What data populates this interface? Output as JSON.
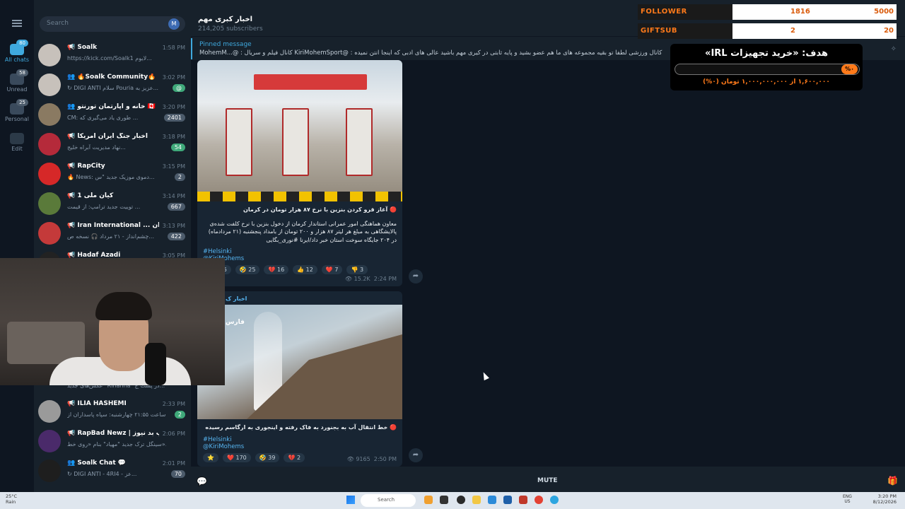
{
  "rail": {
    "items": [
      {
        "label": "All chats",
        "badge": "80"
      },
      {
        "label": "Unread",
        "badge": "58"
      },
      {
        "label": "Personal",
        "badge": "25"
      },
      {
        "label": "Edit",
        "badge": ""
      }
    ]
  },
  "search": {
    "placeholder": "Search"
  },
  "chats": [
    {
      "name": "📢 Soalk",
      "time": "1:58 PM",
      "preview": "https://kick.com/Soalk1 لایوم...",
      "badge": ""
    },
    {
      "name": "👥 🔥Soalk Community🔥",
      "time": "3:02 PM",
      "preview": "↻ DIGI ANTI سلام Pouria عزیز به...",
      "badge": "@"
    },
    {
      "name": "👥 خانه و آپارتمان تورنتو 🇨🇦",
      "time": "3:20 PM",
      "preview": "CM: طوری یاد می‌گیری که ...",
      "badge": "2401"
    },
    {
      "name": "📢 اخبار جنگ ایران امریکا",
      "time": "3:18 PM",
      "preview": "نهاد مدیریت آبراه خلیج...",
      "badge": "54"
    },
    {
      "name": "📢 RapCity",
      "time": "3:15 PM",
      "preview": "🔥 News: دموی موزیک جدید \"س...",
      "badge": "2"
    },
    {
      "name": "📢 کیان ملی 1",
      "time": "3:14 PM",
      "preview": "توییت جدید ترامپ: از قیمت ...",
      "badge": "667"
    },
    {
      "name": "📢 Iran International ... ایران",
      "time": "3:13 PM",
      "preview": "چشم‌انداز - ۲۱ مرداد 🎧 نسخه ص...",
      "badge": "422"
    },
    {
      "name": "📢 Hadaf Azadi",
      "time": "3:05 PM",
      "preview": "",
      "badge": ""
    },
    {
      "name": "",
      "time": "",
      "preview": "عکس‌های جدید \"Rihanna\" در پست ج...",
      "badge": ""
    },
    {
      "name": "📢 ILIA HASHEMI",
      "time": "2:33 PM",
      "preview": "ساعت ۲۱:۵۵ چهارشنبه: سپاه پاسداران از...",
      "badge": "2"
    },
    {
      "name": "📢 RapBad Newz | رپ بد نیوز",
      "time": "2:06 PM",
      "preview": "سینگل ترک جدید \"مهیاد\" بنام «روی خط»...",
      "badge": ""
    },
    {
      "name": "👥 Soalk Chat 💬",
      "time": "2:01 PM",
      "preview": "↻ DIGI ANTI - 4RI4 - عز...",
      "badge": "70"
    }
  ],
  "header": {
    "title": "اخبار کبری مهم",
    "subscribers": "214,205 subscribers"
  },
  "pinned": {
    "label": "Pinned message",
    "text": "MohemM...@ : کانال فیلم و سریال  KiriMohemSport@ : کانال ورزشی   لطفا تو بقیه مجموعه های ما هم عضو بشید و پایه ثابتی در کیری مهم باشید   عالی های ادبی که اینجا آنتن نمیده"
  },
  "posts": [
    {
      "caption_title": "🔴 آغاز قرو کردن بنزین با نرخ ۸۷ هزار تومان در کرمان",
      "caption_body": "معاون هماهنگی امور عمرانی استاندار کرمان از دخول بنزین با نرخ کلفت شده‌ی پالایشگاهی به مبلغ هر لیتر ۸۷ هزار و ۲۰۰ تومان از بامداد پنجشنبه (۲۱ مرداد‌ماه) در ۲۰۴ جایگاه سوخت استان خبر داد/ایرنا #نوری_بگایی",
      "tag1": "#Helsinki",
      "tag2": "@KiriMohems",
      "reactions": [
        "🔥 556",
        "🤣 25",
        "💔 16",
        "👍 12",
        "❤️ 7",
        "👎 3"
      ],
      "views": "15.2K",
      "time": "2:24 PM"
    },
    {
      "channel": "اخبار ک",
      "watermark": "فارس",
      "caption_title": "🔴 خط انتقال آب به بجنورد به فاک رفته و اینجوری به ارگاسم رسیده",
      "tag1": "#Helsinki",
      "tag2": "@KiriMohems",
      "reactions": [
        "⭐",
        "❤️ 170",
        "🤣 39",
        "💔 2"
      ],
      "views": "9165",
      "time": "2:50 PM"
    }
  ],
  "bottombar": {
    "mute": "MUTE"
  },
  "overlay": {
    "follower": {
      "label": "FOLLOWER",
      "current": "1816",
      "goal": "5000"
    },
    "giftsub": {
      "label": "GIFTSUB",
      "current": "2",
      "goal": "20"
    },
    "goal": {
      "title": "هدف: «خرید تجهیزات IRL»",
      "percent": "%۰",
      "amount": "۱,۶۰۰,۰۰۰ از ۱,۰۰۰,۰۰۰,۰۰۰ تومان (۰%)"
    }
  },
  "taskbar": {
    "weather_temp": "25°C",
    "weather_desc": "Rain",
    "search": "Search",
    "lang_1": "ENG",
    "lang_2": "US",
    "time": "3:20 PM",
    "date": "8/12/2026"
  },
  "colors": {
    "accent": "#3fa9de",
    "overlay_orange": "#ff7a1a",
    "bg": "#0e1621"
  }
}
